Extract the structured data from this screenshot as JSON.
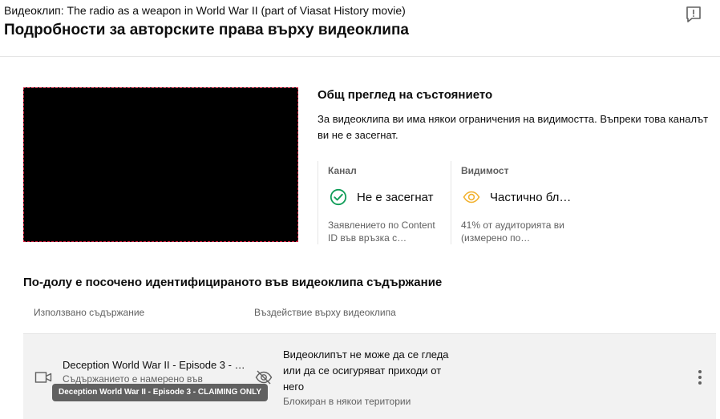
{
  "header": {
    "subtitle": "Видеоклип: The radio as a weapon in World War II (part of Viasat History movie)",
    "title": "Подробности за авторските права върху видеоклипа"
  },
  "overview": {
    "title": "Общ преглед на състоянието",
    "description": "За видеоклипа ви има някои ограничения на видимостта. Въпреки това каналът ви не е засегнат."
  },
  "cards": {
    "channel": {
      "label": "Канал",
      "status": "Не е засегнат",
      "description": "Заявлението по Content ID във връзка с…",
      "icon": "check-circle-icon",
      "color": "#0f9d58"
    },
    "visibility": {
      "label": "Видимост",
      "status": "Частично бл…",
      "description": "41% от аудиторията ви (измерено по…",
      "icon": "eye-icon",
      "color": "#f2b12d"
    }
  },
  "content": {
    "section_title": "По-долу е посочено идентифицираното във видеоклипа съдържание",
    "columns": {
      "used": "Използвано съдържание",
      "impact": "Въздействие върху видеоклипа"
    },
    "rows": [
      {
        "name": "Deception World War II - Episode 3 - C…",
        "sub": "Съдържанието е намерено във",
        "impact": "Видеоклипът не може да се гледа или да се осигуряват приходи от него",
        "impact_sub": "Блокиран в някои територии",
        "tooltip": "Deception World War II - Episode 3 - CLAIMING ONLY"
      }
    ]
  }
}
